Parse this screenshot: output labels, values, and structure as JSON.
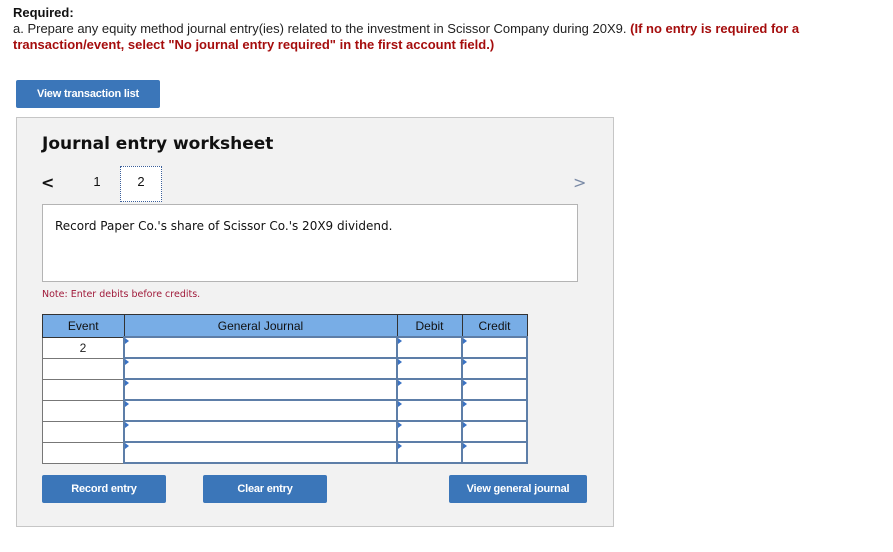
{
  "required": {
    "heading": "Required:",
    "instruction": "a. Prepare any equity method journal entry(ies) related to the investment in Scissor Company during 20X9.",
    "note_red": "(If no entry is required for a transaction/event, select \"No journal entry required\" in the first account field.)"
  },
  "buttons": {
    "view_transaction_list": "View transaction list",
    "record_entry": "Record entry",
    "clear_entry": "Clear entry",
    "view_general_journal": "View general journal"
  },
  "worksheet": {
    "title": "Journal entry worksheet",
    "nav": {
      "prev_icon": "chevron-left",
      "next_icon": "chevron-right",
      "prev_glyph": "<",
      "next_glyph": ">",
      "tabs": [
        "1",
        "2"
      ],
      "active_tab": "2"
    },
    "description": "Record Paper Co.'s share of Scissor Co.'s 20X9 dividend.",
    "note": "Note: Enter debits before credits.",
    "table": {
      "headers": [
        "Event",
        "General Journal",
        "Debit",
        "Credit"
      ],
      "rows": [
        {
          "event": "2",
          "account": "",
          "debit": "",
          "credit": ""
        },
        {
          "event": "",
          "account": "",
          "debit": "",
          "credit": ""
        },
        {
          "event": "",
          "account": "",
          "debit": "",
          "credit": ""
        },
        {
          "event": "",
          "account": "",
          "debit": "",
          "credit": ""
        },
        {
          "event": "",
          "account": "",
          "debit": "",
          "credit": ""
        },
        {
          "event": "",
          "account": "",
          "debit": "",
          "credit": ""
        }
      ]
    }
  },
  "colors": {
    "button_blue": "#3b76b9",
    "header_blue": "#78ade6",
    "required_red": "#a50d0d",
    "note_red": "#a01a3a",
    "panel_bg": "#f2f2f2"
  }
}
